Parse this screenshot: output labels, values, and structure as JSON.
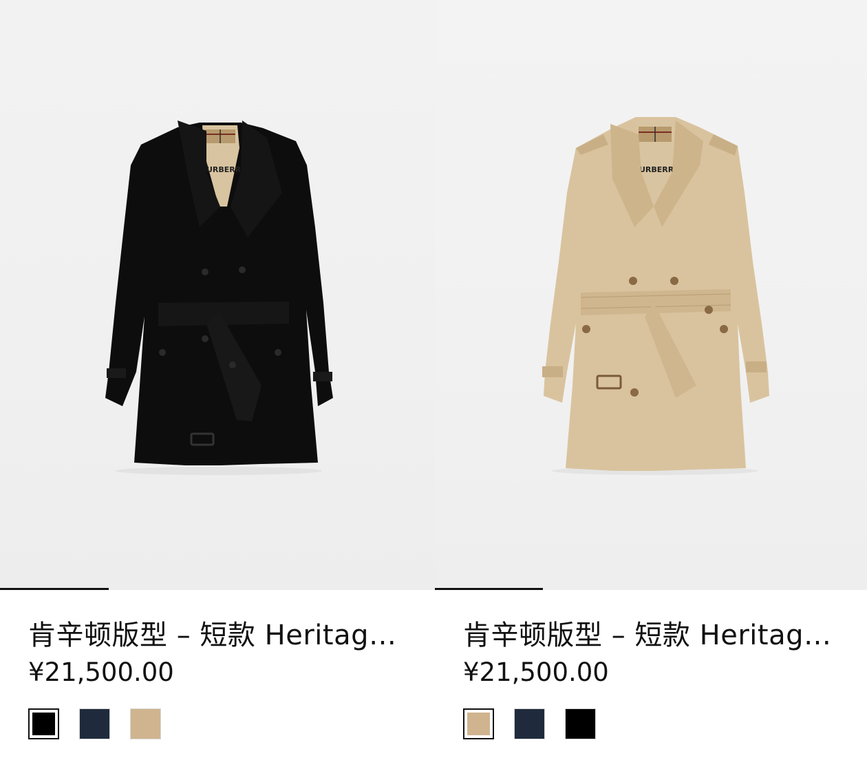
{
  "products": [
    {
      "title": "肯辛顿版型 – 短款 Heritage Trench 风衣",
      "price": "¥21,500.00",
      "image_alt": "black trench coat",
      "coat_color": "#0d0d0d",
      "swatches": [
        {
          "name": "black",
          "color": "#000000",
          "selected": true
        },
        {
          "name": "navy",
          "color": "#1f2a3c",
          "selected": false
        },
        {
          "name": "honey",
          "color": "#cfb48f",
          "selected": false
        }
      ]
    },
    {
      "title": "肯辛顿版型 – 短款 Heritage Trench 风衣",
      "price": "¥21,500.00",
      "image_alt": "honey trench coat",
      "coat_color": "#d6bf98",
      "swatches": [
        {
          "name": "honey",
          "color": "#cfb48f",
          "selected": true
        },
        {
          "name": "navy",
          "color": "#1f2a3c",
          "selected": false
        },
        {
          "name": "black",
          "color": "#000000",
          "selected": false
        }
      ]
    }
  ]
}
